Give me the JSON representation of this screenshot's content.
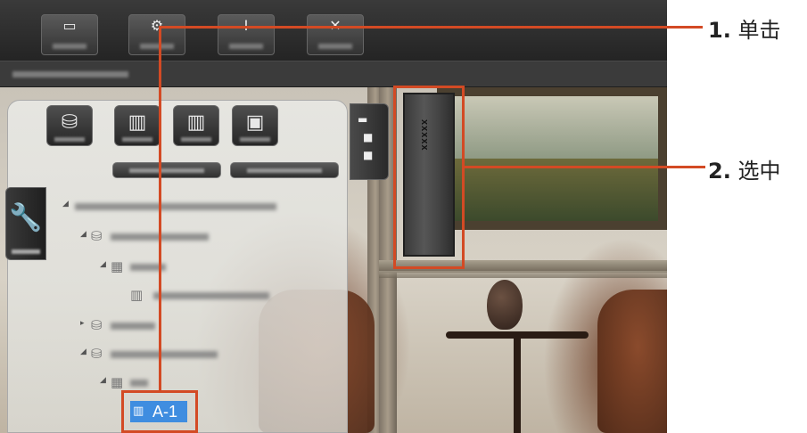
{
  "callouts": [
    {
      "number": "1.",
      "text": "单击"
    },
    {
      "number": "2.",
      "text": "选中"
    }
  ],
  "tree": {
    "selected_item_label": "A-1"
  },
  "device": {
    "label": "xxxxx"
  },
  "colors": {
    "highlight": "#d34a24",
    "selection": "#3f8de0"
  },
  "icons": {
    "toolbar": [
      "inbox-icon",
      "gear-icon",
      "info-icon",
      "close-icon"
    ],
    "panel_buttons": [
      "database-sync-icon",
      "rack-edit-icon",
      "rack-delete-icon",
      "rack-add-icon"
    ]
  }
}
